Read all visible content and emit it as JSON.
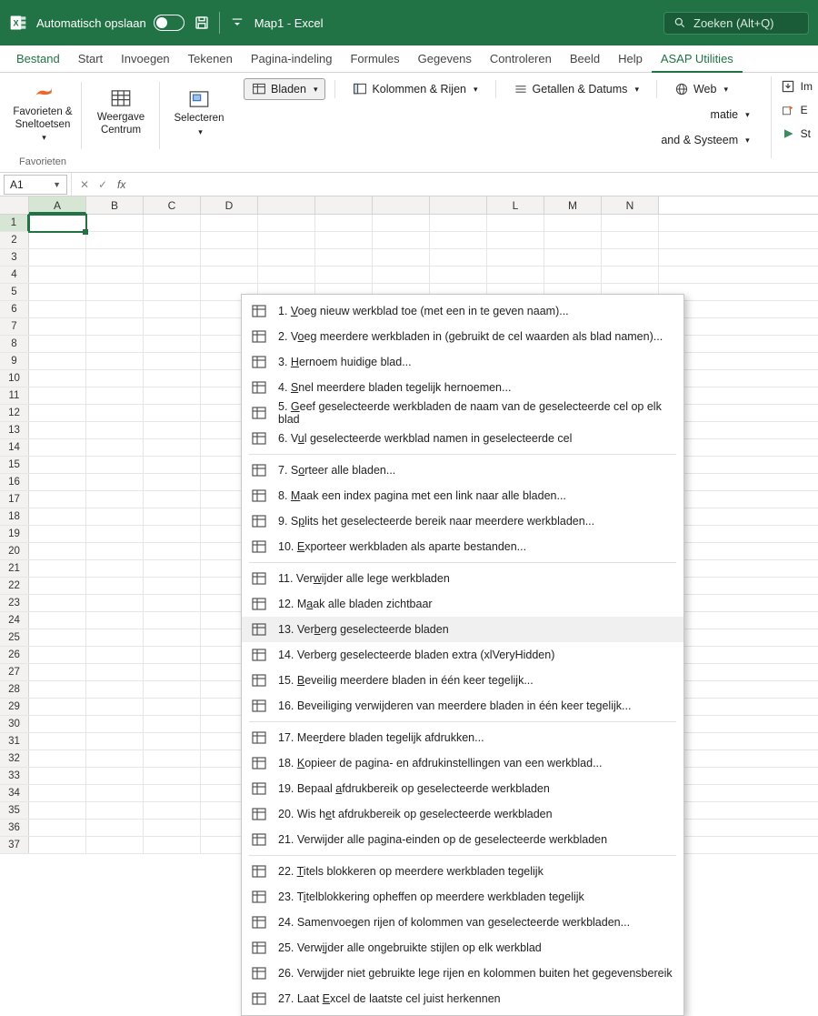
{
  "titlebar": {
    "autosave_label": "Automatisch opslaan",
    "doc_title": "Map1 - Excel",
    "search_placeholder": "Zoeken (Alt+Q)"
  },
  "tabs": [
    "Bestand",
    "Start",
    "Invoegen",
    "Tekenen",
    "Pagina-indeling",
    "Formules",
    "Gegevens",
    "Controleren",
    "Beeld",
    "Help",
    "ASAP Utilities"
  ],
  "active_tab_index": 10,
  "ribbon": {
    "fav_label": "Favorieten &\nSneltoetsen",
    "fav_group": "Favorieten",
    "view_label": "Weergave\nCentrum",
    "select_label": "Selecteren",
    "bladen": "Bladen",
    "kolrij": "Kolommen & Rijen",
    "getdat": "Getallen & Datums",
    "web": "Web",
    "informatie": "matie",
    "bestand_systeem": "and & Systeem",
    "start": "St",
    "im": "Im",
    "ex": "E"
  },
  "namebox": "A1",
  "columns": [
    "A",
    "B",
    "C",
    "D",
    "",
    "",
    "",
    "",
    "L",
    "M",
    "N"
  ],
  "row_count": 37,
  "menu": {
    "highlight_index": 12,
    "groups": [
      [
        {
          "n": "1",
          "t": "Voeg nieuw werkblad toe (met een in te geven naam)...",
          "u": 0
        },
        {
          "n": "2",
          "t": "Voeg meerdere werkbladen in (gebruikt de cel waarden als blad namen)...",
          "u": 1
        },
        {
          "n": "3",
          "t": "Hernoem huidige blad...",
          "u": 0
        },
        {
          "n": "4",
          "t": "Snel meerdere bladen tegelijk hernoemen...",
          "u": 0
        },
        {
          "n": "5",
          "t": "Geef geselecteerde werkbladen de naam van de geselecteerde cel op elk blad",
          "u": 0
        },
        {
          "n": "6",
          "t": "Vul geselecteerde werkblad namen in  geselecteerde cel",
          "u": 1
        }
      ],
      [
        {
          "n": "7",
          "t": "Sorteer alle bladen...",
          "u": 1
        },
        {
          "n": "8",
          "t": "Maak een index pagina met een link naar alle bladen...",
          "u": 0
        },
        {
          "n": "9",
          "t": "Splits het geselecteerde bereik naar meerdere werkbladen...",
          "u": 1
        },
        {
          "n": "10",
          "t": "Exporteer werkbladen als aparte bestanden...",
          "u": 0
        }
      ],
      [
        {
          "n": "11",
          "t": "Verwijder alle lege werkbladen",
          "u": 3
        },
        {
          "n": "12",
          "t": "Maak alle bladen zichtbaar",
          "u": 1
        },
        {
          "n": "13",
          "t": "Verberg geselecteerde bladen",
          "u": 3
        },
        {
          "n": "14",
          "t": "Verberg geselecteerde bladen extra (xlVeryHidden)",
          "u": -1
        },
        {
          "n": "15",
          "t": "Beveilig meerdere bladen in één keer tegelijk...",
          "u": 0
        },
        {
          "n": "16",
          "t": "Beveiliging verwijderen van meerdere bladen in één keer tegelijk...",
          "u": -1
        }
      ],
      [
        {
          "n": "17",
          "t": "Meerdere bladen tegelijk afdrukken...",
          "u": 3
        },
        {
          "n": "18",
          "t": "Kopieer de pagina- en afdrukinstellingen van een werkblad...",
          "u": 0
        },
        {
          "n": "19",
          "t": "Bepaal afdrukbereik op geselecteerde werkbladen",
          "u": 7
        },
        {
          "n": "20",
          "t": "Wis het afdrukbereik op geselecteerde werkbladen",
          "u": 5
        },
        {
          "n": "21",
          "t": "Verwijder alle pagina-einden op de geselecteerde werkbladen",
          "u": -1
        }
      ],
      [
        {
          "n": "22",
          "t": "Titels blokkeren op meerdere werkbladen tegelijk",
          "u": 0
        },
        {
          "n": "23",
          "t": "Titelblokkering opheffen op meerdere werkbladen tegelijk",
          "u": 1
        },
        {
          "n": "24",
          "t": "Samenvoegen rijen of kolommen van geselecteerde werkbladen...",
          "u": -1
        },
        {
          "n": "25",
          "t": "Verwijder alle ongebruikte stijlen op elk werkblad",
          "u": 4
        },
        {
          "n": "26",
          "t": "Verwijder niet gebruikte lege rijen en kolommen buiten het gegevensbereik",
          "u": 4
        },
        {
          "n": "27",
          "t": "Laat Excel de laatste cel juist herkennen",
          "u": 5
        }
      ]
    ]
  }
}
